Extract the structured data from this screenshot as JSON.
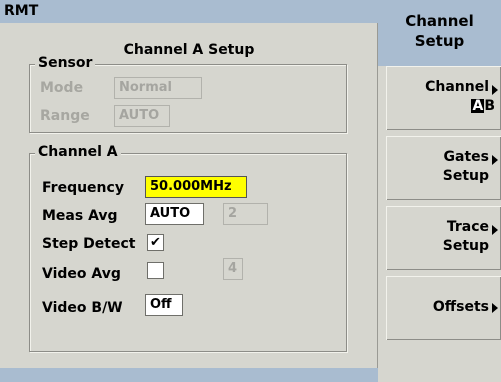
{
  "header": {
    "title": "RMT"
  },
  "setup": {
    "title": "Channel A Setup"
  },
  "sensor": {
    "legend": "Sensor",
    "mode_label": "Mode",
    "mode_value": "Normal",
    "range_label": "Range",
    "range_value": "AUTO"
  },
  "channel": {
    "legend": "Channel A",
    "frequency_label": "Frequency",
    "frequency_value": "50.000MHz",
    "meas_avg_label": "Meas Avg",
    "meas_avg_value": "AUTO",
    "meas_avg_count": "2",
    "step_detect_label": "Step Detect",
    "step_detect_checked": true,
    "step_detect_mark": "✔",
    "video_avg_label": "Video Avg",
    "video_avg_checked": false,
    "video_avg_count": "4",
    "video_bw_label": "Video B/W",
    "video_bw_value": "Off"
  },
  "menu": {
    "title_line1": "Channel",
    "title_line2": "Setup",
    "softkeys": [
      {
        "line1": "Channel",
        "line2_a": "A",
        "line2_b": "B"
      },
      {
        "line1": "Gates",
        "line2": "Setup"
      },
      {
        "line1": "Trace",
        "line2": "Setup"
      },
      {
        "line1": "Offsets"
      }
    ]
  },
  "colors": {
    "title_bar": "#a9bcd0",
    "panel": "#d6d6cf",
    "highlight": "#ffff00"
  }
}
